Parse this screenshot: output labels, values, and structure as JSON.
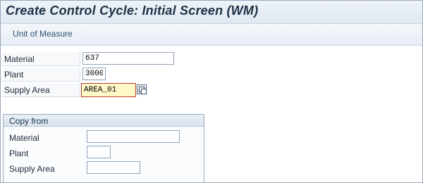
{
  "window": {
    "title": "Create Control Cycle: Initial Screen (WM)"
  },
  "toolbar": {
    "unit_of_measure": "Unit of Measure"
  },
  "main": {
    "material_label": "Material",
    "material_value": "637",
    "plant_label": "Plant",
    "plant_value": "3000",
    "supply_area_label": "Supply Area",
    "supply_area_value": "AREA_01"
  },
  "copy_from": {
    "title": "Copy from",
    "material_label": "Material",
    "material_value": "",
    "plant_label": "Plant",
    "plant_value": "",
    "supply_area_label": "Supply Area",
    "supply_area_value": ""
  }
}
